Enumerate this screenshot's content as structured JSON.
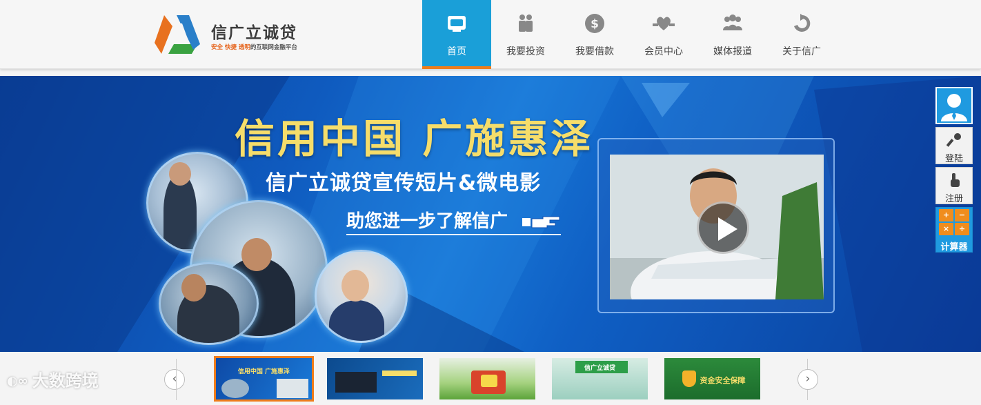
{
  "brand": {
    "name": "信广立诚贷",
    "slogan_highlight": "安全 快捷 透明",
    "slogan_rest": "的互联网金融平台"
  },
  "nav": {
    "items": [
      {
        "label": "首页",
        "icon": "atm-card-icon",
        "active": true
      },
      {
        "label": "我要投资",
        "icon": "people-icon",
        "active": false
      },
      {
        "label": "我要借款",
        "icon": "dollar-coin-icon",
        "active": false
      },
      {
        "label": "会员中心",
        "icon": "heart-hands-icon",
        "active": false
      },
      {
        "label": "媒体报道",
        "icon": "group-icon",
        "active": false
      },
      {
        "label": "关于信广",
        "icon": "refresh-arrow-icon",
        "active": false
      }
    ]
  },
  "banner": {
    "headline": "信用中国  广施惠泽",
    "subline": "信广立诚贷宣传短片&微电影",
    "cta": "助您进一步了解信广"
  },
  "side": {
    "login": "登陆",
    "register": "注册",
    "calculator": "计算器",
    "calc_symbols": [
      "+",
      "−",
      "×",
      "÷"
    ]
  },
  "thumbs": [
    {
      "title": "信用中国  广施惠泽"
    },
    {
      "title": ""
    },
    {
      "title": ""
    },
    {
      "title": "信广立诚贷"
    },
    {
      "title": "资金安全保障"
    }
  ],
  "watermark": "大数跨境",
  "colors": {
    "accent_blue": "#1a9fd8",
    "accent_orange": "#ef7d1b",
    "headline_yellow": "#f6dd6a"
  }
}
